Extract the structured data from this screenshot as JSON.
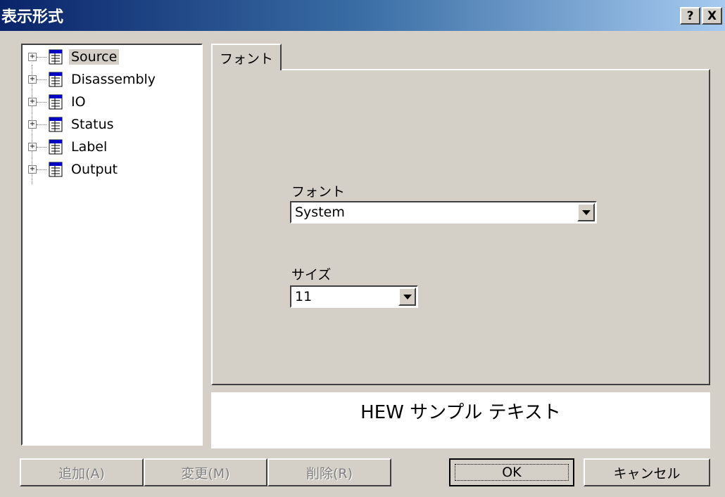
{
  "window": {
    "title": "表示形式",
    "help_label": "?",
    "close_label": "X"
  },
  "tree": {
    "items": [
      {
        "label": "Source",
        "selected": true
      },
      {
        "label": "Disassembly",
        "selected": false
      },
      {
        "label": "IO",
        "selected": false
      },
      {
        "label": "Status",
        "selected": false
      },
      {
        "label": "Label",
        "selected": false
      },
      {
        "label": "Output",
        "selected": false
      }
    ]
  },
  "tabs": [
    {
      "label": "フォント",
      "active": true
    }
  ],
  "font": {
    "label": "フォント",
    "value": "System"
  },
  "size": {
    "label": "サイズ",
    "value": "11"
  },
  "sample": {
    "text": "HEW サンプル テキスト"
  },
  "buttons": {
    "add": "追加(A)",
    "change": "変更(M)",
    "delete": "削除(R)",
    "ok": "OK",
    "cancel": "キャンセル"
  }
}
